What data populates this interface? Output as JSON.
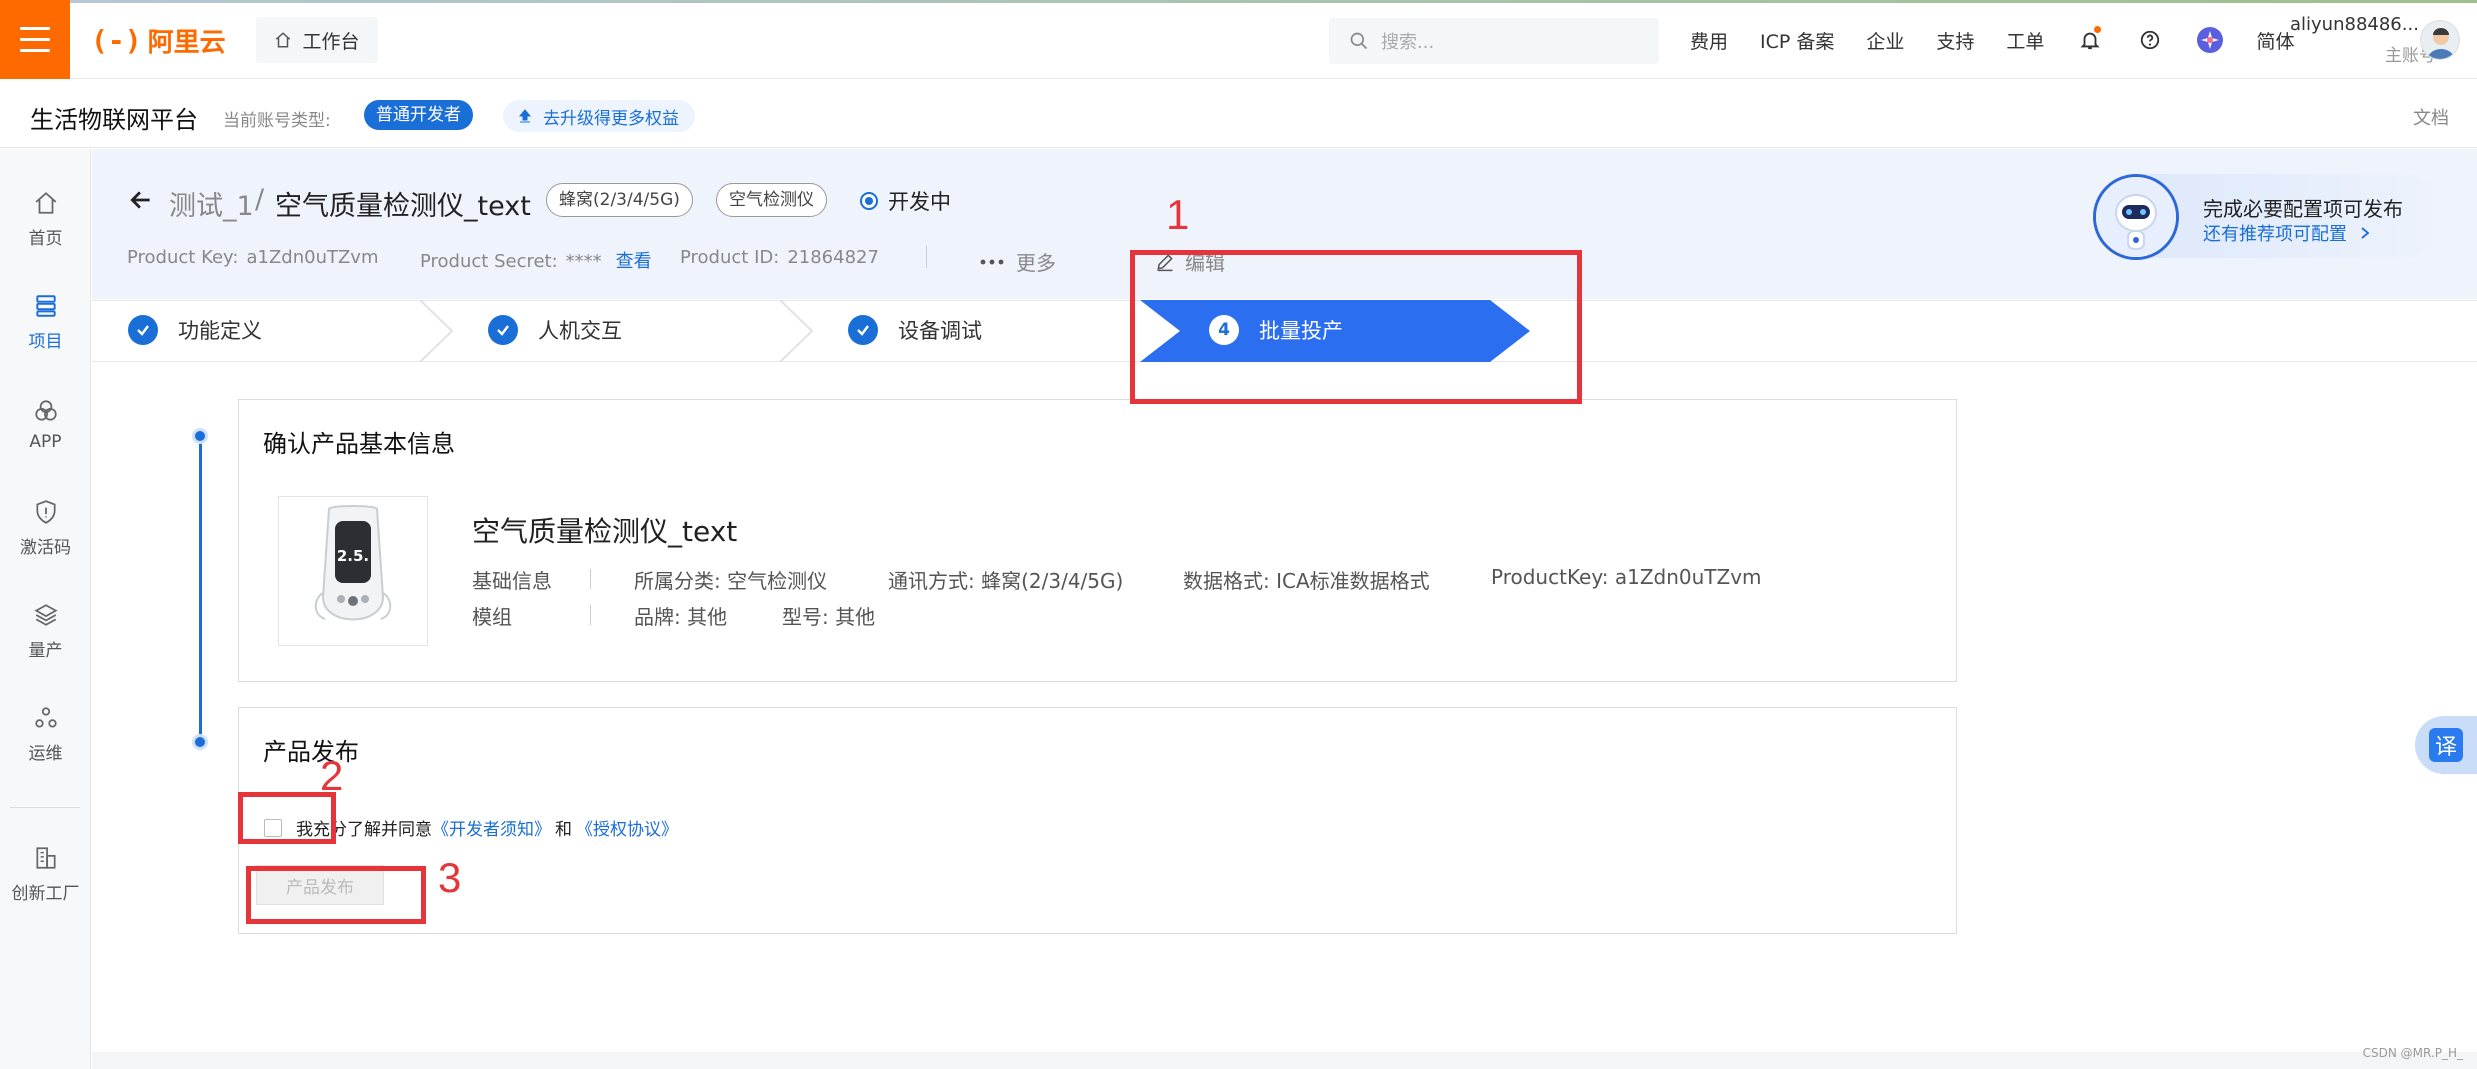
{
  "topbar": {
    "logo_bracket": "(-)",
    "logo_text": "阿里云",
    "workbench": "工作台",
    "search_placeholder": "搜索...",
    "nav": [
      "费用",
      "ICP 备案",
      "企业",
      "支持",
      "工单"
    ],
    "lang": "简体",
    "account_name": "aliyun88486...",
    "account_role": "主账号"
  },
  "subbar": {
    "platform": "生活物联网平台",
    "account_type_label": "当前账号类型:",
    "account_type": "普通开发者",
    "upgrade": "去升级得更多权益",
    "docs": "文档"
  },
  "sidebar": {
    "items": [
      {
        "label": "首页",
        "icon": "home-icon"
      },
      {
        "label": "项目",
        "icon": "list-icon"
      },
      {
        "label": "APP",
        "icon": "app-icon"
      },
      {
        "label": "激活码",
        "icon": "shield-icon"
      },
      {
        "label": "量产",
        "icon": "layers-icon"
      },
      {
        "label": "运维",
        "icon": "nodes-icon"
      },
      {
        "label": "创新工厂",
        "icon": "building-icon"
      }
    ],
    "active_index": 1
  },
  "header": {
    "project": "测试_1",
    "separator": "/",
    "product": "空气质量检测仪_text",
    "tags": [
      "蜂窝(2/3/4/5G)",
      "空气检测仪"
    ],
    "status": "开发中",
    "product_key_label": "Product Key:",
    "product_key": "a1Zdn0uTZvm",
    "product_secret_label": "Product Secret:",
    "product_secret": "****",
    "view": "查看",
    "product_id_label": "Product ID:",
    "product_id": "21864827",
    "more": "更多",
    "edit": "编辑"
  },
  "publish_tip": {
    "title": "完成必要配置项可发布",
    "link": "还有推荐项可配置"
  },
  "steps": {
    "done": [
      "功能定义",
      "人机交互",
      "设备调试"
    ],
    "active_number": "4",
    "active_label": "批量投产"
  },
  "confirm_card": {
    "title": "确认产品基本信息",
    "product_name": "空气质量检测仪_text",
    "device_display": "2.5.",
    "basic_info_label": "基础信息",
    "module_label": "模组",
    "category_label": "所属分类:",
    "category": "空气检测仪",
    "comm_label": "通讯方式:",
    "comm": "蜂窝(2/3/4/5G)",
    "format_label": "数据格式:",
    "format": "ICA标准数据格式",
    "pk_label": "ProductKey:",
    "pk": "a1Zdn0uTZvm",
    "brand_label": "品牌:",
    "brand": "其他",
    "model_label": "型号:",
    "model": "其他"
  },
  "publish_card": {
    "title": "产品发布",
    "agree_prefix": "我充分了解并同意",
    "agree_link1": "《开发者须知》",
    "agree_and": "和",
    "agree_link2": "《授权协议》",
    "button": "产品发布"
  },
  "annotations": [
    "1",
    "2",
    "3"
  ],
  "translate": "译",
  "watermark": "CSDN @MR.P_H_",
  "colors": {
    "brand_orange": "#ff6a00",
    "primary_blue": "#1a6ed8",
    "annotation_red": "#e6353a"
  }
}
